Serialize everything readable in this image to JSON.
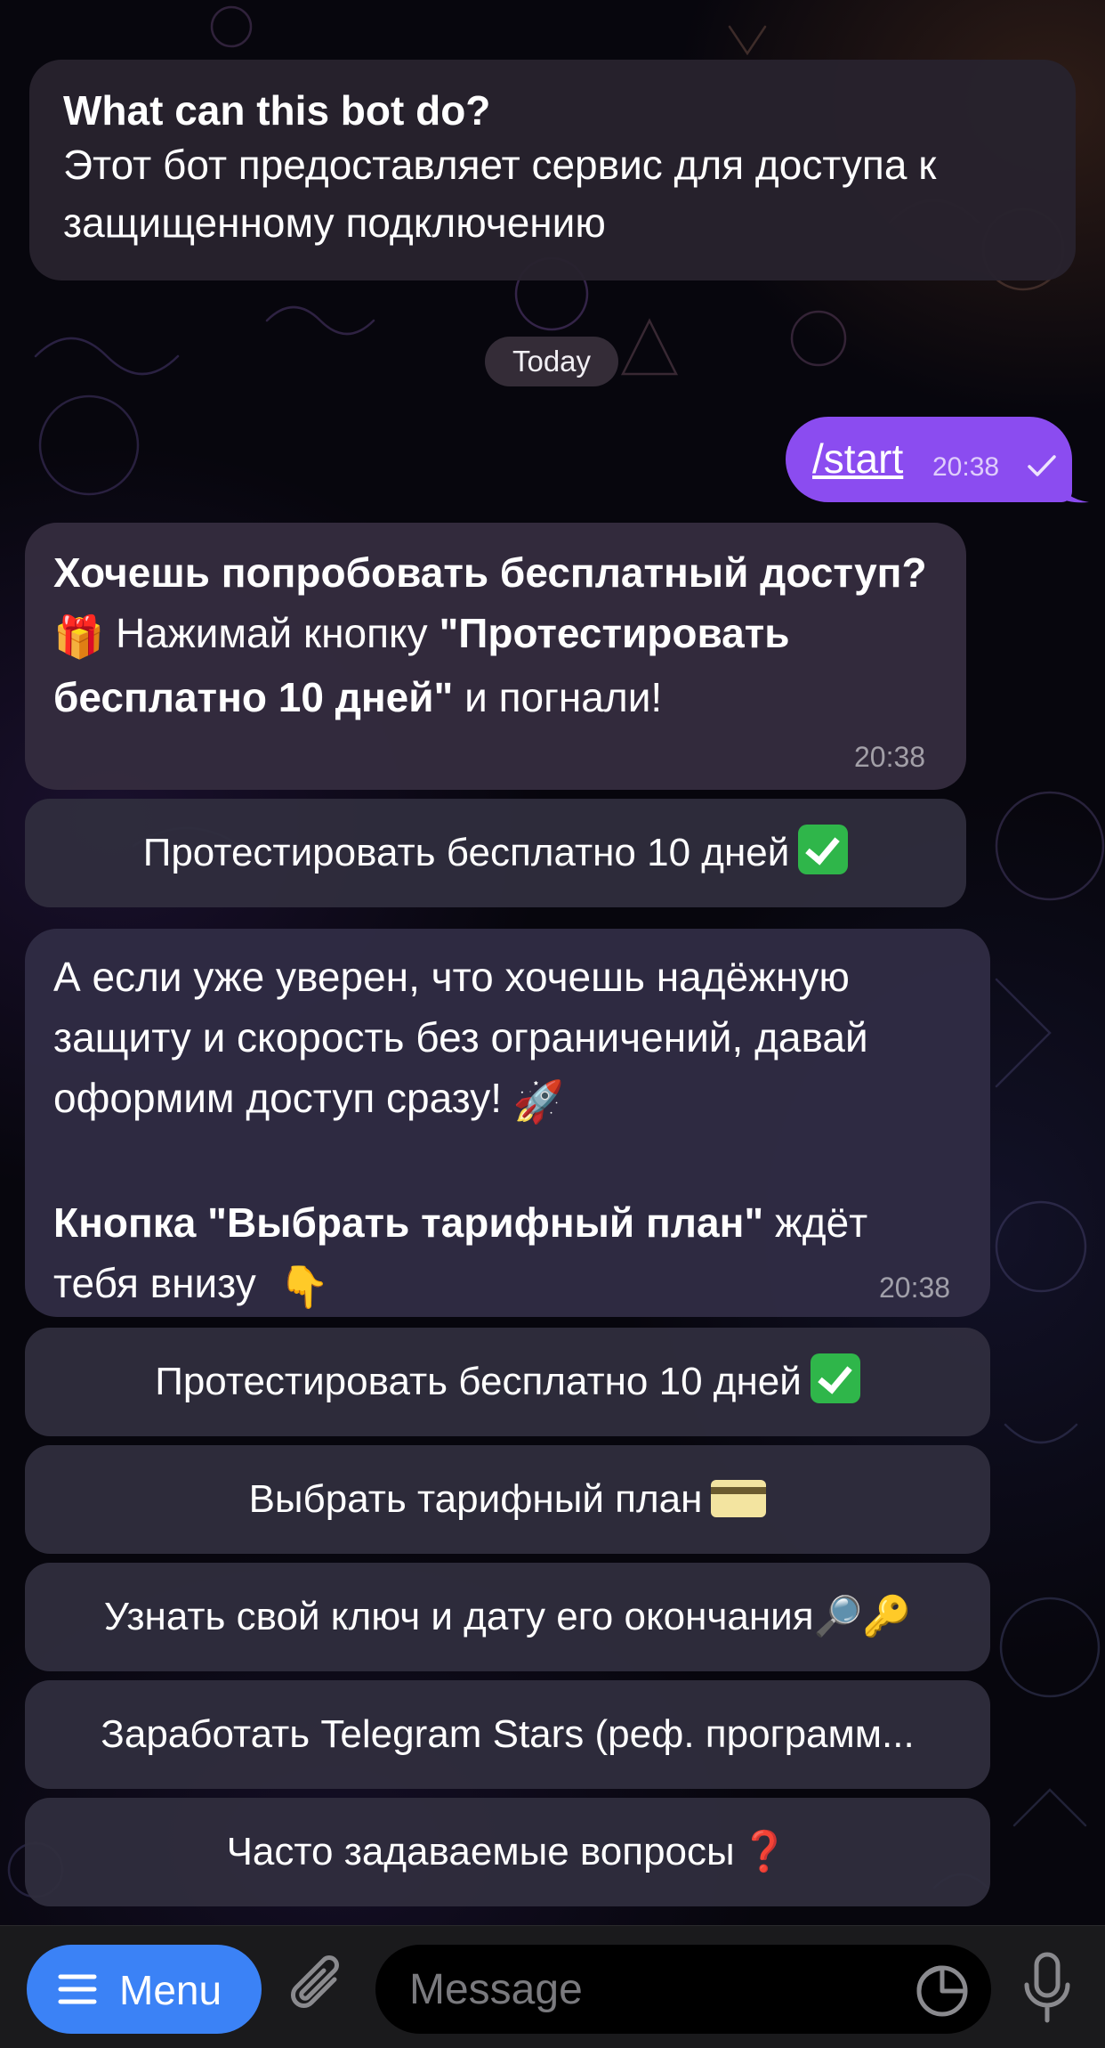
{
  "intro": {
    "title": "What can this bot do?",
    "text": "Этот бот предоставляет сервис для доступа к защищенному подключению"
  },
  "date_separator": "Today",
  "outgoing": {
    "text": "/start",
    "time": "20:38"
  },
  "message1": {
    "bold1": "Хочешь попробовать бесплатный доступ?",
    "emoji_gift": "🎁",
    "text1": " Нажимай кнопку ",
    "bold2": "\"Протестировать бесплатно 10 дней\"",
    "text2": " и погнали!",
    "time": "20:38"
  },
  "message1_button": "Протестировать бесплатно 10 дней",
  "message2": {
    "text1": "А если уже уверен, что хочешь надёжную защиту и скорость без ограничений, давай оформим доступ сразу!",
    "emoji_rocket": "🚀",
    "bold1": "Кнопка \"Выбрать тарифный план\"",
    "text2": " ждёт тебя внизу",
    "emoji_point": "👇",
    "time": "20:38"
  },
  "keyboard": {
    "btn_trial": "Протестировать бесплатно 10 дней",
    "btn_plan": "Выбрать тарифный план",
    "btn_key": "Узнать свой ключ и дату его окончания",
    "btn_key_emojis": "🔎🔑",
    "btn_stars": "Заработать Telegram Stars (реф. программ...",
    "btn_faq": "Часто задаваемые вопросы",
    "btn_faq_emoji": "❓"
  },
  "bottom": {
    "menu_label": "Menu",
    "input_placeholder": "Message"
  },
  "colors": {
    "outgoing_bubble": "#8b4cf0",
    "menu_button": "#3b82f6",
    "check_emoji": "#2fb64a"
  },
  "icons": [
    "menu-icon",
    "paperclip-icon",
    "sticker-icon",
    "microphone-icon",
    "read-check-icon"
  ]
}
